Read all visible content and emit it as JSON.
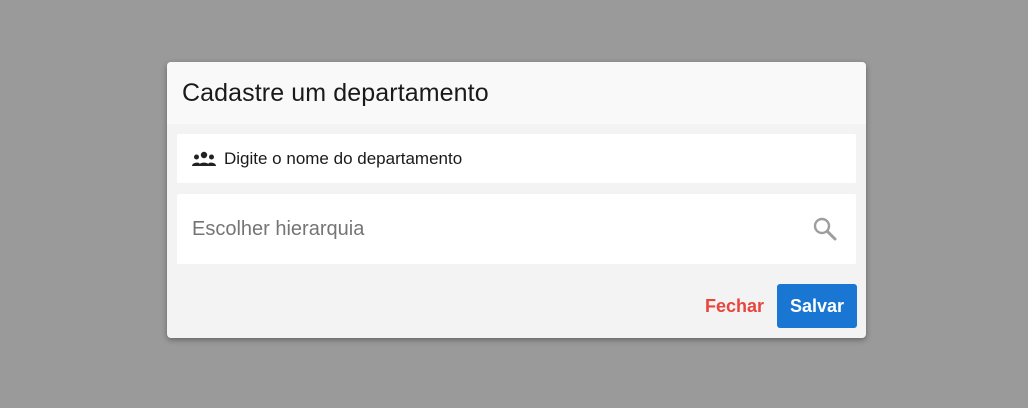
{
  "dialog": {
    "title": "Cadastre um departamento",
    "name_field": {
      "icon": "people-icon",
      "label": "Digite o nome do departamento"
    },
    "hierarchy_field": {
      "value": "",
      "placeholder": "Escolher hierarquia",
      "icon": "search-icon"
    },
    "actions": {
      "close_label": "Fechar",
      "save_label": "Salvar"
    }
  },
  "colors": {
    "overlay": "#9a9a9a",
    "dialog_background": "#f3f3f3",
    "close_button_text": "#e8453c",
    "save_button_background": "#1976d2",
    "save_button_text": "#ffffff"
  }
}
